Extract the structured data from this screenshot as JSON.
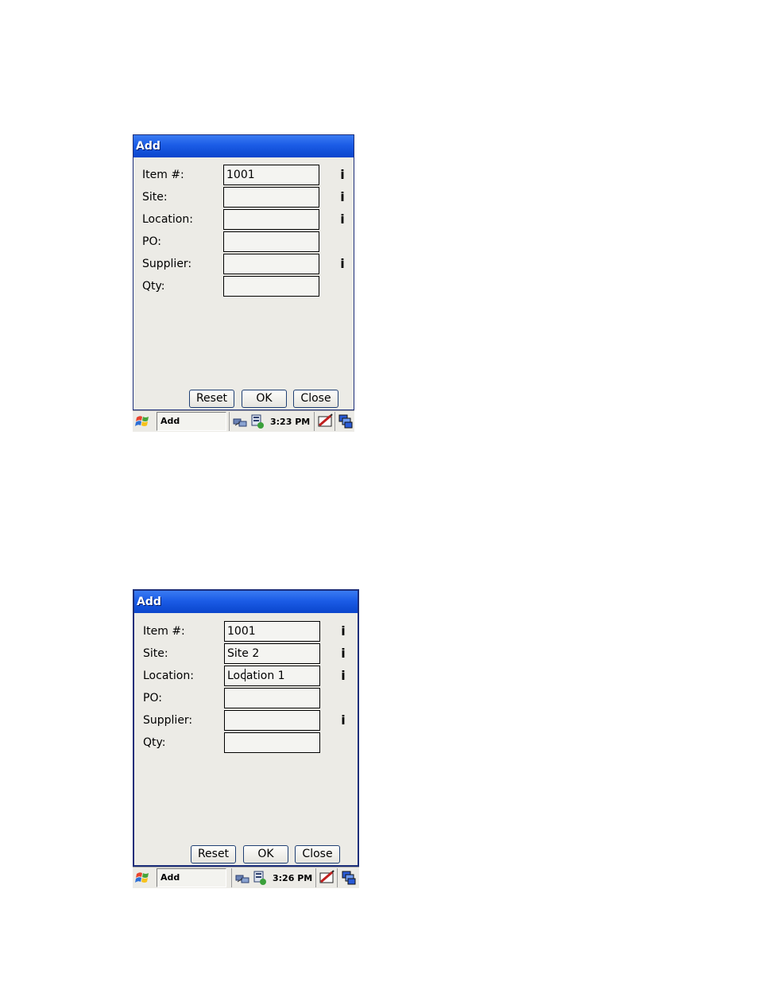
{
  "screens": [
    {
      "title": "Add",
      "fields": [
        {
          "label": "Item #:",
          "value": "1001",
          "info": "i"
        },
        {
          "label": "Site:",
          "value": "",
          "info": "i"
        },
        {
          "label": "Location:",
          "value": "",
          "info": "i"
        },
        {
          "label": "PO:",
          "value": "",
          "info": ""
        },
        {
          "label": "Supplier:",
          "value": "",
          "info": "i"
        },
        {
          "label": "Qty:",
          "value": "",
          "info": ""
        }
      ],
      "buttons": {
        "reset": "Reset",
        "ok": "OK",
        "close": "Close"
      },
      "taskbar": {
        "task": "Add",
        "clock": "3:23 PM"
      }
    },
    {
      "title": "Add",
      "fields": [
        {
          "label": "Item #:",
          "value": "1001",
          "info": "i"
        },
        {
          "label": "Site:",
          "value": "Site 2",
          "info": "i"
        },
        {
          "label": "Location:",
          "value": "Location 1",
          "info": "i"
        },
        {
          "label": "PO:",
          "value": "",
          "info": ""
        },
        {
          "label": "Supplier:",
          "value": "",
          "info": "i"
        },
        {
          "label": "Qty:",
          "value": "",
          "info": ""
        }
      ],
      "buttons": {
        "reset": "Reset",
        "ok": "OK",
        "close": "Close"
      },
      "taskbar": {
        "task": "Add",
        "clock": "3:26 PM"
      }
    }
  ],
  "colors": {
    "titlebar": "#1b5ce6",
    "window_bg": "#ecebe6"
  },
  "icons": [
    "windows-start-icon",
    "network-icon",
    "battery-icon",
    "input-panel-icon",
    "desktop-icon"
  ]
}
